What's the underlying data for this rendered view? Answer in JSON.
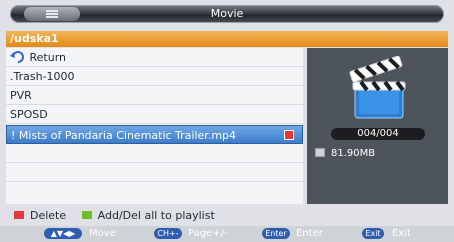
{
  "window": {
    "title": "Movie"
  },
  "path": "/udska1",
  "list": {
    "items": [
      {
        "label": "Return",
        "icon": "return-arrow-icon"
      },
      {
        "label": ".Trash-1000"
      },
      {
        "label": "PVR"
      },
      {
        "label": "SPOSD"
      },
      {
        "label": "! Mists of Pandaria Cinematic Trailer.mp4",
        "selected": true,
        "checked": true
      }
    ]
  },
  "side": {
    "preview_icon": "clapperboard-icon",
    "counter": "004/004",
    "file_size": "81.90MB"
  },
  "legend": {
    "delete_label": "Delete",
    "add_label": "Add/Del all to playlist",
    "colors": {
      "red": "#e23b3b",
      "green": "#6ebe2c"
    }
  },
  "nav": {
    "move_key": "▲▼◀▶",
    "move_label": "Move",
    "page_key": "CH+-",
    "page_label": "Page+/-",
    "enter_key": "Enter",
    "enter_label": "Enter",
    "exit_key": "Exit",
    "exit_label": "Exit"
  }
}
